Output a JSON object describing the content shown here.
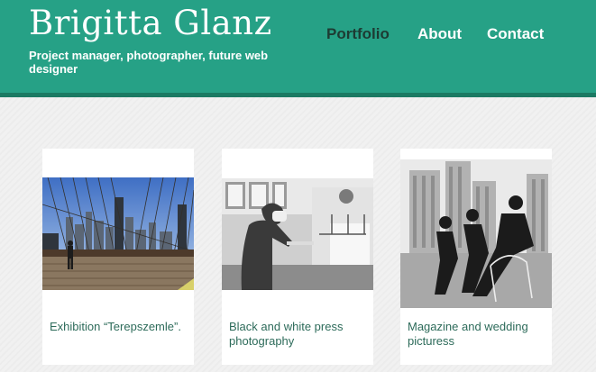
{
  "header": {
    "title": "Brigitta Glanz",
    "tagline": "Project manager, photographer, future web designer"
  },
  "nav": {
    "items": [
      {
        "label": "Portfolio",
        "active": true
      },
      {
        "label": "About",
        "active": false
      },
      {
        "label": "Contact",
        "active": false
      }
    ]
  },
  "portfolio": {
    "cards": [
      {
        "caption": "Exhibition “Terepszemle”."
      },
      {
        "caption": "Black and white press photography"
      },
      {
        "caption": "Magazine and wedding picturess"
      }
    ]
  },
  "colors": {
    "header": "#26a186",
    "header_shadow": "#1b7a63",
    "nav_active": "#1d3b33",
    "caption": "#2d6b5a"
  }
}
